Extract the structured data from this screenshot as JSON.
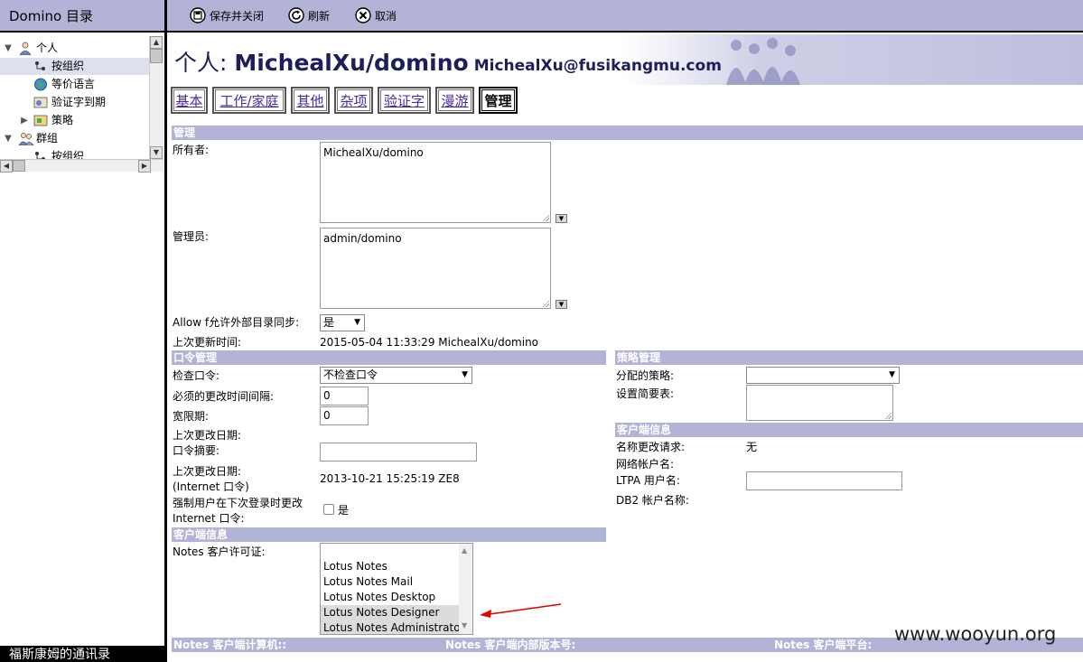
{
  "app": {
    "left_title": "Domino 目录",
    "left_bottom_text": "福斯康姆的通讯录"
  },
  "nav": {
    "items": [
      {
        "label": "个人",
        "icon": "person-icon"
      },
      {
        "label": "按组织",
        "icon": "org-icon"
      },
      {
        "label": "等价语言",
        "icon": "globe-icon"
      },
      {
        "label": "验证字到期",
        "icon": "certificate-icon"
      },
      {
        "label": "策略",
        "icon": "policy-icon"
      },
      {
        "label": "群组",
        "icon": "group-icon"
      },
      {
        "label": "按组织",
        "icon": "org-icon"
      }
    ]
  },
  "toolbar": {
    "save_close": "保存并关闭",
    "refresh": "刷新",
    "cancel": "取消"
  },
  "header": {
    "prefix": "个人: ",
    "name": "MichealXu/domino",
    "email": "MichealXu@fusikangmu.com"
  },
  "tabs": [
    "基本",
    "工作/家庭",
    "其他",
    "杂项",
    "验证字",
    "漫游",
    "管理"
  ],
  "admin": {
    "section_title": "管理",
    "owner_label": "所有者:",
    "owner_value": "MichealXu/domino",
    "admins_label": "管理员:",
    "admins_value": "admin/domino",
    "sync_label": "Allow f允许外部目录同步:",
    "sync_value": "是",
    "last_update_label": "上次更新时间:",
    "last_update_value": "2015-05-04 11:33:29 MichealXu/domino"
  },
  "password": {
    "section_title": "口令管理",
    "check_label": "检查口令:",
    "check_value": "不检查口令",
    "change_interval_label": "必须的更改时间间隔:",
    "change_interval_value": "0",
    "grace_label": "宽限期:",
    "grace_value": "0",
    "last_change_label": "上次更改日期:",
    "digest_label": "口令摘要:",
    "digest_value": "",
    "inet_change_label1": "上次更改日期:",
    "inet_change_label2": "(Internet 口令)",
    "inet_change_value": "2013-10-21 15:25:19 ZE8",
    "force_label1": "强制用户在下次登录时更改",
    "force_label2": "Internet 口令:",
    "force_option": "是"
  },
  "policy": {
    "section_title": "策略管理",
    "assigned_label": "分配的策略:",
    "assigned_value": "",
    "settings_label": "设置简要表:",
    "settings_value": ""
  },
  "client_right": {
    "section_title": "客户端信息",
    "name_change_label": "名称更改请求:",
    "name_change_value": "无",
    "network_label": "网络帐户名:",
    "ltpa_label": "LTPA 用户名:",
    "ltpa_value": "",
    "db2_label": "DB2 帐户名称:"
  },
  "client_left": {
    "section_title": "客户端信息",
    "license_label": "Notes 客户许可证:",
    "licenses": [
      "Lotus Notes",
      "Lotus Notes Mail",
      "Lotus Notes Desktop",
      "Lotus Notes Designer",
      "Lotus Notes Administrato"
    ]
  },
  "bottom_bar": {
    "col1": "Notes 客户端计算机::",
    "col2": "Notes 客户端内部版本号:",
    "col3": "Notes 客户端平台:"
  },
  "watermark": "www.wooyun.org",
  "colors": {
    "section_bar": "#b3b3d7",
    "link": "#4b2aa0",
    "header_text": "#1b1f5c",
    "annotation_arrow": "#e00000"
  }
}
